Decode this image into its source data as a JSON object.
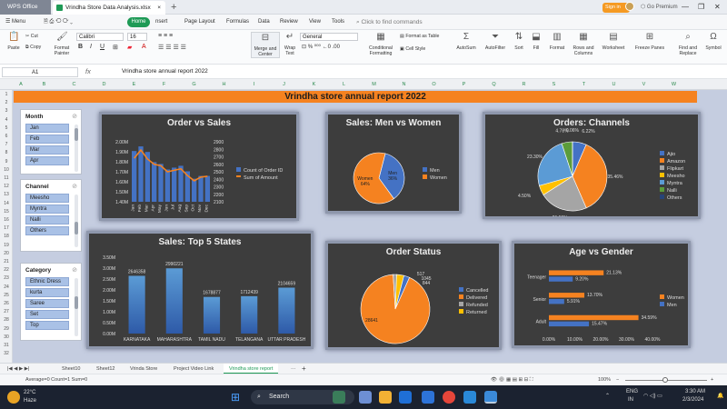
{
  "app": {
    "name": "WPS Office",
    "doc_tab": "Vrindha Store Data Analysis.xlsx",
    "sign_in": "Sign in",
    "go_premium": "Go Premium"
  },
  "menu": {
    "items": [
      "Menu",
      "Home",
      "nsert",
      "Page Layout",
      "Formulas",
      "Data",
      "Review",
      "View",
      "Tools"
    ],
    "find": "Click to find commands"
  },
  "ribbon": {
    "paste": "Paste",
    "cut": "Cut",
    "copy": "Copy",
    "format_painter": "Format Painter",
    "font": "Calibri",
    "size": "16",
    "merge": "Merge and Center",
    "wrap": "Wrap Text",
    "number_format": "General",
    "conditional": "Conditional Formatting",
    "format_table": "Format as Table",
    "cell_style": "Cell Style",
    "autosum": "AutoSum",
    "autofilter": "AutoFilter",
    "sort": "Sort",
    "fill": "Fill",
    "format": "Format",
    "rows_cols": "Rows and Columns",
    "worksheet": "Worksheet",
    "freeze": "Freeze Panes",
    "find_replace": "Find and Replace",
    "symbol": "Symbol"
  },
  "formula_bar": {
    "cell_ref": "A1",
    "fx": "fx",
    "formula": "Vrindha store annual report 2022"
  },
  "columns": [
    "A",
    "B",
    "C",
    "D",
    "E",
    "F",
    "G",
    "H",
    "I",
    "J",
    "K",
    "L",
    "M",
    "N",
    "O",
    "P",
    "Q",
    "R",
    "S",
    "T",
    "U",
    "V",
    "W"
  ],
  "rows": [
    "1",
    "2",
    "3",
    "4",
    "5",
    "6",
    "7",
    "8",
    "9",
    "10",
    "11",
    "12",
    "13",
    "14",
    "15",
    "16",
    "17",
    "18",
    "19",
    "20",
    "21",
    "22",
    "23",
    "24",
    "25",
    "26",
    "27",
    "28",
    "29",
    "30",
    "31",
    "32"
  ],
  "banner": "Vrindha store annual report 2022",
  "slicers": [
    {
      "title": "Month",
      "items": [
        "Jan",
        "Feb",
        "Mar",
        "Apr"
      ]
    },
    {
      "title": "Channel",
      "items": [
        "Meesho",
        "Myntra",
        "Nalli",
        "Others"
      ]
    },
    {
      "title": "Category",
      "items": [
        "Ethnic Dress",
        "kurta",
        "Saree",
        "Set",
        "Top"
      ]
    }
  ],
  "colors": {
    "orange": "#f58220",
    "blue": "#4472c4",
    "gray": "#a5a5a5",
    "yellow": "#ffc000",
    "green": "#5b9c3b",
    "lightblue": "#5b9bd5",
    "navy": "#264478"
  },
  "chart_data": [
    {
      "type": "line",
      "title": "Order vs Sales",
      "categories": [
        "Jan",
        "Feb",
        "Mar",
        "Apr",
        "May",
        "Jun",
        "Jul",
        "Aug",
        "Sep",
        "Oct",
        "Nov",
        "Dec"
      ],
      "series": [
        {
          "name": "Count of Order ID",
          "kind": "bar",
          "axis": "left",
          "values": [
            1.9,
            1.95,
            1.89,
            1.78,
            1.76,
            1.7,
            1.72,
            1.74,
            1.68,
            1.6,
            1.63,
            1.63
          ]
        },
        {
          "name": "Sum of Amount",
          "kind": "line",
          "axis": "right",
          "values": [
            2680,
            2790,
            2670,
            2600,
            2580,
            2500,
            2520,
            2540,
            2450,
            2380,
            2430,
            2440
          ]
        }
      ],
      "y_left_ticks": [
        "2.00M",
        "1.90M",
        "1.80M",
        "1.70M",
        "1.60M",
        "1.50M",
        "1.40M"
      ],
      "y_right_ticks": [
        "2900",
        "2800",
        "2700",
        "2600",
        "2500",
        "2400",
        "2300",
        "2200",
        "2100"
      ],
      "ylim_left": [
        1.35,
        2.0
      ],
      "ylim_right": [
        2100,
        2900
      ]
    },
    {
      "type": "pie",
      "title": "Sales: Men vs Women",
      "categories": [
        "Men",
        "Women"
      ],
      "values": [
        36,
        64
      ],
      "labels": [
        "Men\n36%",
        "Women\n64%"
      ],
      "legend": "right"
    },
    {
      "type": "pie",
      "title": "Orders: Channels",
      "categories": [
        "Ajio",
        "Amazon",
        "Flipkart",
        "Meesho",
        "Myntra",
        "Nalli",
        "Others"
      ],
      "values": [
        6.22,
        35.46,
        21.59,
        4.5,
        23.3,
        4.78,
        0.06
      ],
      "labels": [
        "6.22%",
        "35.46%",
        "21.59%",
        "4.50%",
        "23.30%",
        "4.78%",
        "0.06%"
      ],
      "legend": "right"
    },
    {
      "type": "bar",
      "title": "Sales: Top 5 States",
      "categories": [
        "KARNATAKA",
        "MAHARASHTRA",
        "TAMIL NADU",
        "TELANGANA",
        "UTTAR PRADESH"
      ],
      "values": [
        2646358,
        2990221,
        1678877,
        1712439,
        2104659
      ],
      "labels": [
        "2646358",
        "2990221",
        "1678877",
        "1712439",
        "2104659"
      ],
      "y_ticks": [
        "3.50M",
        "3.00M",
        "2.50M",
        "2.00M",
        "1.50M",
        "1.00M",
        "0.50M",
        "0.00M"
      ],
      "ylim": [
        0,
        3500000
      ]
    },
    {
      "type": "pie",
      "title": "Order Status",
      "categories": [
        "Cancelled",
        "Delivered",
        "Refunded",
        "Returned"
      ],
      "values": [
        844,
        28641,
        517,
        1045
      ],
      "labels": [
        "844",
        "28641",
        "517",
        "1045"
      ],
      "legend": "right"
    },
    {
      "type": "bar",
      "orientation": "horizontal",
      "title": "Age vs Gender",
      "categories": [
        "Adult",
        "Senior",
        "Teenager"
      ],
      "series": [
        {
          "name": "Men",
          "values": [
            15.47,
            5.91,
            9.2
          ]
        },
        {
          "name": "Women",
          "values": [
            34.59,
            13.7,
            21.13
          ]
        }
      ],
      "labels": {
        "Men": [
          "15.47%",
          "5.91%",
          "9.20%"
        ],
        "Women": [
          "34.59%",
          "13.70%",
          "21.13%"
        ]
      },
      "x_ticks": [
        "0.00%",
        "10.00%",
        "20.00%",
        "30.00%",
        "40.00%"
      ],
      "xlim": [
        0,
        40
      ]
    }
  ],
  "sheet_tabs": [
    "Sheet10",
    "Sheet12",
    "Vrinda Store",
    "Project Video Link",
    "Vrindha store report"
  ],
  "status": {
    "summary": "Average=0  Count=1  Sum=0",
    "zoom": "100%"
  },
  "taskbar": {
    "temp": "22°C",
    "weather": "Haze",
    "search": "Search",
    "lang1": "ENG",
    "lang2": "IN",
    "time": "3:30 AM",
    "date": "2/3/2024"
  }
}
